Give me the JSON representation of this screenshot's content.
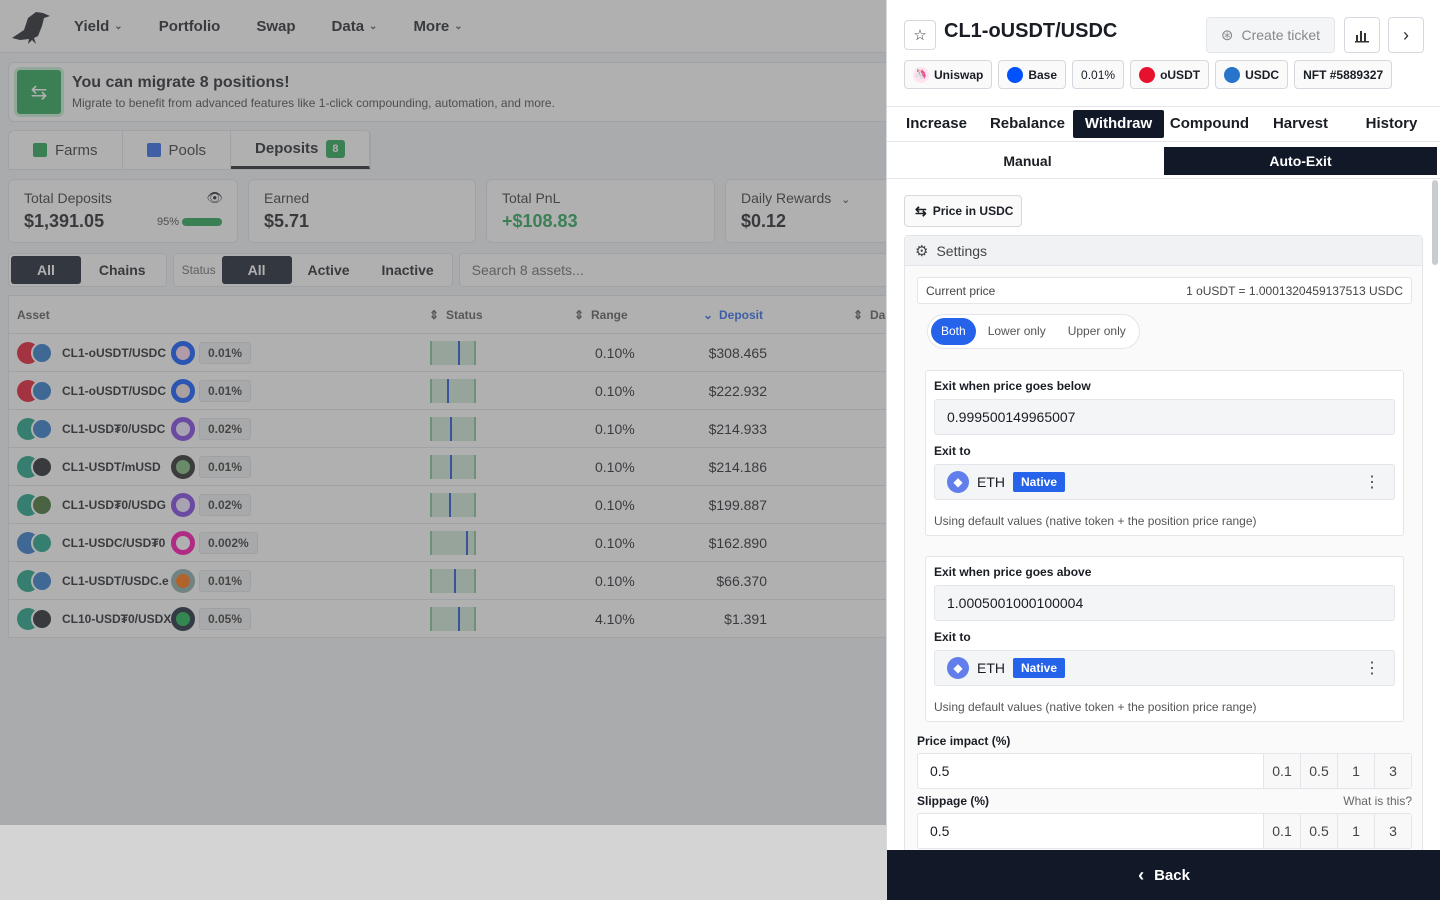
{
  "nav": {
    "items": [
      {
        "label": "Yield",
        "dropdown": true
      },
      {
        "label": "Portfolio",
        "dropdown": false
      },
      {
        "label": "Swap",
        "dropdown": false
      },
      {
        "label": "Data",
        "dropdown": true
      },
      {
        "label": "More",
        "dropdown": true
      }
    ]
  },
  "banner": {
    "title": "You can migrate 8 positions!",
    "subtitle": "Migrate to benefit from advanced features like 1-click compounding, automation, and more."
  },
  "tabs": {
    "farms": "Farms",
    "pools": "Pools",
    "deposits": "Deposits",
    "deposits_count": "8"
  },
  "stats": {
    "total_deposits_label": "Total Deposits",
    "total_deposits_value": "$1,391.05",
    "total_deposits_pct": "95%",
    "earned_label": "Earned",
    "earned_value": "$5.71",
    "pnl_label": "Total PnL",
    "pnl_value": "+$108.83",
    "daily_label": "Daily Rewards",
    "daily_value": "$0.12"
  },
  "filters": {
    "all": "All",
    "chains": "Chains",
    "status_label": "Status",
    "status_all": "All",
    "active": "Active",
    "inactive": "Inactive",
    "search_placeholder": "Search 8 assets..."
  },
  "table": {
    "headers": {
      "asset": "Asset",
      "status": "Status",
      "range": "Range",
      "deposit": "Deposit",
      "daily": "Da"
    },
    "rows": [
      {
        "asset": "CL1-oUSDT/USDC",
        "fee": "0.01%",
        "range": "0.10%",
        "deposit": "$308.465",
        "marker": 0.62
      },
      {
        "asset": "CL1-oUSDT/USDC",
        "fee": "0.01%",
        "range": "0.10%",
        "deposit": "$222.932",
        "marker": 0.35
      },
      {
        "asset": "CL1-USD₮0/USDC",
        "fee": "0.02%",
        "range": "0.10%",
        "deposit": "$214.933",
        "marker": 0.42
      },
      {
        "asset": "CL1-USDT/mUSD",
        "fee": "0.01%",
        "range": "0.10%",
        "deposit": "$214.186",
        "marker": 0.42
      },
      {
        "asset": "CL1-USD₮0/USDG",
        "fee": "0.02%",
        "range": "0.10%",
        "deposit": "$199.887",
        "marker": 0.4
      },
      {
        "asset": "CL1-USDC/USD₮0",
        "fee": "0.002%",
        "range": "0.10%",
        "deposit": "$162.890",
        "marker": 0.8
      },
      {
        "asset": "CL1-USDT/USDC.e",
        "fee": "0.01%",
        "range": "0.10%",
        "deposit": "$66.370",
        "marker": 0.52
      },
      {
        "asset": "CL10-USD₮0/USDXL",
        "fee": "0.05%",
        "range": "4.10%",
        "deposit": "$1.391",
        "marker": 0.62
      }
    ]
  },
  "panel": {
    "title": "CL1-oUSDT/USDC",
    "create_ticket": "Create ticket",
    "chips": {
      "dex": "Uniswap",
      "chain": "Base",
      "fee": "0.01%",
      "token0": "oUSDT",
      "token1": "USDC",
      "nft": "NFT #5889327"
    },
    "main_tabs": [
      "Increase",
      "Rebalance",
      "Withdraw",
      "Compound",
      "Harvest",
      "History"
    ],
    "active_main_tab": "Withdraw",
    "sub_tabs": [
      "Manual",
      "Auto-Exit"
    ],
    "active_sub_tab": "Auto-Exit",
    "price_in": "Price in USDC",
    "settings_label": "Settings",
    "current_price_label": "Current price",
    "current_price_value": "1 oUSDT = 1.0001320459137513 USDC",
    "modes": [
      "Both",
      "Lower only",
      "Upper only"
    ],
    "active_mode": "Both",
    "lower": {
      "label": "Exit when price goes below",
      "value": "0.999500149965007",
      "exit_to_label": "Exit to",
      "token": "ETH",
      "tag": "Native",
      "hint": "Using default values (native token + the position price range)"
    },
    "upper": {
      "label": "Exit when price goes above",
      "value": "1.0005001000100004",
      "exit_to_label": "Exit to",
      "token": "ETH",
      "tag": "Native",
      "hint": "Using default values (native token + the position price range)"
    },
    "price_impact": {
      "label": "Price impact (%)",
      "value": "0.5",
      "presets": [
        "0.1",
        "0.5",
        "1",
        "3"
      ]
    },
    "slippage": {
      "label": "Slippage (%)",
      "help": "What is this?",
      "value": "0.5",
      "presets": [
        "0.1",
        "0.5",
        "1",
        "3"
      ]
    },
    "back": "Back"
  },
  "colors": {
    "accent_blue": "#2563eb",
    "dark": "#111827",
    "green": "#1fa352"
  }
}
